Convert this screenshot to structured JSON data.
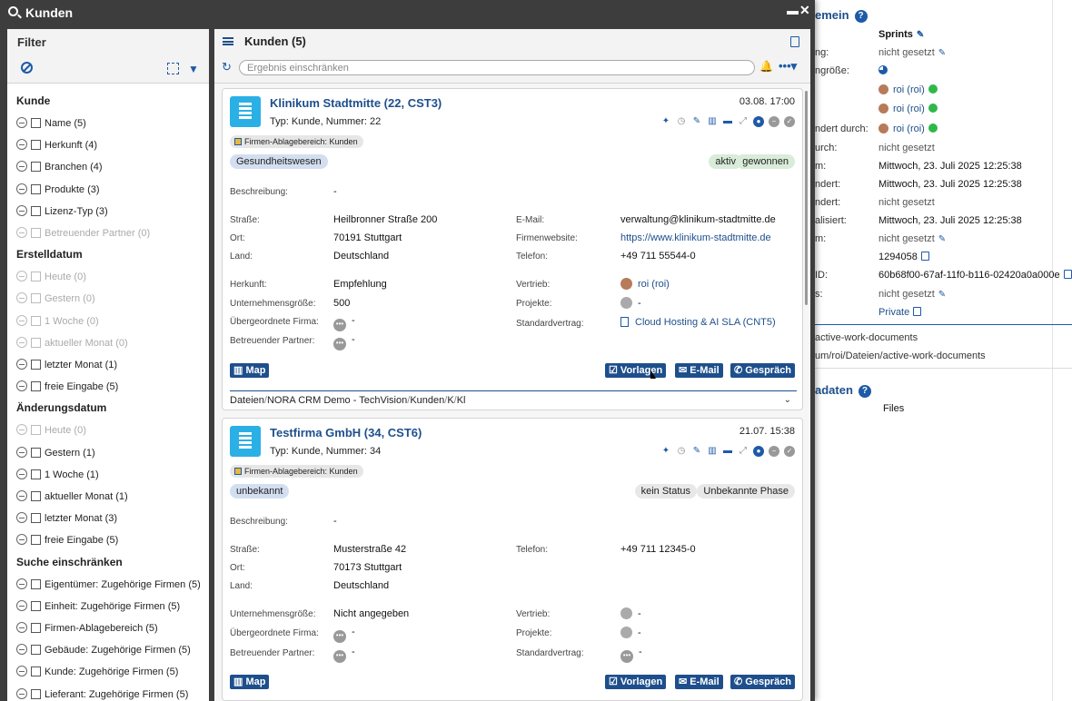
{
  "window": {
    "title": "Kunden"
  },
  "background": {
    "section_title": "emein",
    "section2_title": "adaten",
    "files_label": "Files",
    "rows": [
      {
        "label": "",
        "value": "Sprints"
      },
      {
        "label": "ng:",
        "value": "nicht gesetzt"
      },
      {
        "label": "ngröße:",
        "value": ""
      },
      {
        "label": "",
        "value": "roi (roi)"
      },
      {
        "label": "",
        "value": "roi (roi)"
      },
      {
        "label": "ndert durch:",
        "value": "roi (roi)"
      },
      {
        "label": "urch:",
        "value": "nicht gesetzt"
      },
      {
        "label": "m:",
        "value": "Mittwoch, 23. Juli 2025 12:25:38"
      },
      {
        "label": "ndert:",
        "value": "Mittwoch, 23. Juli 2025 12:25:38"
      },
      {
        "label": "ndert:",
        "value": "nicht gesetzt"
      },
      {
        "label": "alisiert:",
        "value": "Mittwoch, 23. Juli 2025 12:25:38"
      },
      {
        "label": "m:",
        "value": "nicht gesetzt"
      },
      {
        "label": "",
        "value": "1294058"
      },
      {
        "label": "ID:",
        "value": "60b68f00-67af-11f0-b116-02420a0a000e"
      },
      {
        "label": "s:",
        "value": "nicht gesetzt"
      },
      {
        "label": "",
        "value": "Private"
      }
    ],
    "path1": "active-work-documents",
    "path2": "um/roi/Dateien/active-work-documents"
  },
  "filter": {
    "title": "Filter",
    "sections": [
      {
        "title": "Kunde",
        "items": [
          {
            "label": "Name (5)",
            "disabled": false
          },
          {
            "label": "Herkunft (4)",
            "disabled": false
          },
          {
            "label": "Branchen (4)",
            "disabled": false
          },
          {
            "label": "Produkte (3)",
            "disabled": false
          },
          {
            "label": "Lizenz-Typ (3)",
            "disabled": false
          },
          {
            "label": "Betreuender Partner (0)",
            "disabled": true
          }
        ]
      },
      {
        "title": "Erstelldatum",
        "items": [
          {
            "label": "Heute (0)",
            "disabled": true
          },
          {
            "label": "Gestern (0)",
            "disabled": true
          },
          {
            "label": "1 Woche (0)",
            "disabled": true
          },
          {
            "label": "aktueller Monat (0)",
            "disabled": true
          },
          {
            "label": "letzter Monat (1)",
            "disabled": false
          },
          {
            "label": "freie Eingabe (5)",
            "disabled": false
          }
        ]
      },
      {
        "title": "Änderungsdatum",
        "items": [
          {
            "label": "Heute (0)",
            "disabled": true
          },
          {
            "label": "Gestern (1)",
            "disabled": false
          },
          {
            "label": "1 Woche (1)",
            "disabled": false
          },
          {
            "label": "aktueller Monat (1)",
            "disabled": false
          },
          {
            "label": "letzter Monat (3)",
            "disabled": false
          },
          {
            "label": "freie Eingabe (5)",
            "disabled": false
          }
        ]
      },
      {
        "title": "Suche einschränken",
        "items": [
          {
            "label": "Eigentümer: Zugehörige Firmen (5)",
            "disabled": false
          },
          {
            "label": "Einheit: Zugehörige Firmen (5)",
            "disabled": false
          },
          {
            "label": "Firmen-Ablagebereich (5)",
            "disabled": false
          },
          {
            "label": "Gebäude: Zugehörige Firmen (5)",
            "disabled": false
          },
          {
            "label": "Kunde: Zugehörige Firmen (5)",
            "disabled": false
          },
          {
            "label": "Lieferant: Zugehörige Firmen (5)",
            "disabled": false
          }
        ]
      }
    ]
  },
  "main": {
    "title": "Kunden (5)",
    "search_placeholder": "Ergebnis einschränken",
    "cards": [
      {
        "name": "Klinikum Stadtmitte (22, CST3)",
        "date": "03.08. 17:00",
        "type": "Typ: Kunde, Nummer: 22",
        "area": "Firmen-Ablagebereich: Kunden",
        "tag": "Gesundheitswesen",
        "status": "aktiv",
        "phase": "gewonnen",
        "beschreibung_label": "Beschreibung:",
        "beschreibung": "-",
        "strasse_label": "Straße:",
        "strasse": "Heilbronner Straße 200",
        "ort_label": "Ort:",
        "ort": "70191 Stuttgart",
        "land_label": "Land:",
        "land": "Deutschland",
        "email_label": "E-Mail:",
        "email": "verwaltung@klinikum-stadtmitte.de",
        "web_label": "Firmenwebsite:",
        "web": "https://www.klinikum-stadtmitte.de",
        "tel_label": "Telefon:",
        "tel": "+49 711 55544-0",
        "herkunft_label": "Herkunft:",
        "herkunft": "Empfehlung",
        "groesse_label": "Unternehmensgröße:",
        "groesse": "500",
        "uebergeordnet_label": "Übergeordnete Firma:",
        "uebergeordnet": "-",
        "partner_label": "Betreuender Partner:",
        "partner": "-",
        "vertrieb_label": "Vertrieb:",
        "vertrieb": "roi (roi)",
        "projekte_label": "Projekte:",
        "projekte": "-",
        "vertrag_label": "Standardvertrag:",
        "vertrag": "Cloud Hosting & AI SLA (CNT5)",
        "btn_map": "Map",
        "btn_vorlagen": "Vorlagen",
        "btn_email": "E-Mail",
        "btn_gespraech": "Gespräch",
        "path": [
          "Dateien",
          "NORA CRM Demo - TechVision",
          "Kunden",
          "K",
          "Kl"
        ]
      },
      {
        "name": "Testfirma GmbH (34, CST6)",
        "date": "21.07. 15:38",
        "type": "Typ: Kunde, Nummer: 34",
        "area": "Firmen-Ablagebereich: Kunden",
        "tag": "unbekannt",
        "status": "kein Status",
        "phase": "Unbekannte Phase",
        "beschreibung_label": "Beschreibung:",
        "beschreibung": "-",
        "strasse_label": "Straße:",
        "strasse": "Musterstraße 42",
        "ort_label": "Ort:",
        "ort": "70173 Stuttgart",
        "land_label": "Land:",
        "land": "Deutschland",
        "tel_label": "Telefon:",
        "tel": "+49 711 12345-0",
        "groesse_label": "Unternehmensgröße:",
        "groesse": "Nicht angegeben",
        "uebergeordnet_label": "Übergeordnete Firma:",
        "uebergeordnet": "-",
        "partner_label": "Betreuender Partner:",
        "partner": "-",
        "vertrieb_label": "Vertrieb:",
        "vertrieb": "-",
        "projekte_label": "Projekte:",
        "projekte": "-",
        "vertrag_label": "Standardvertrag:",
        "vertrag": "-",
        "btn_map": "Map",
        "btn_vorlagen": "Vorlagen",
        "btn_email": "E-Mail",
        "btn_gespraech": "Gespräch"
      }
    ]
  }
}
